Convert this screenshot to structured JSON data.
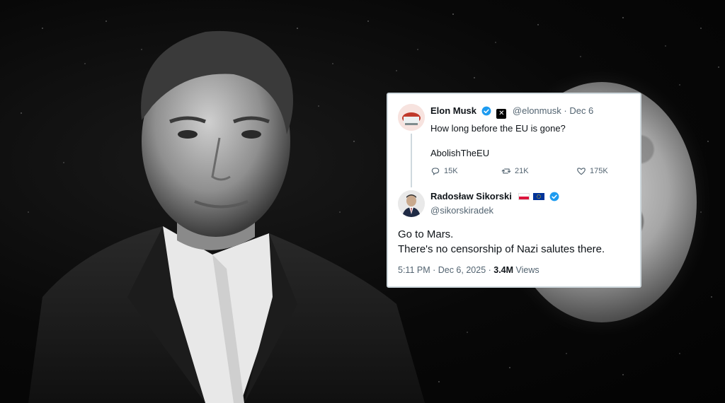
{
  "tweet": {
    "author_name": "Elon Musk",
    "author_handle": "@elonmusk",
    "date": "Dec 6",
    "line1": "How long before the EU is gone?",
    "line2": "AbolishTheEU",
    "replies": "15K",
    "reposts": "21K",
    "likes": "175K"
  },
  "reply": {
    "author_name": "Radosław Sikorski",
    "author_handle": "@sikorskiradek",
    "line1": "Go to Mars.",
    "line2": "There's no censorship of Nazi salutes there.",
    "time": "5:11 PM · Dec 6, 2025 · ",
    "views_count": "3.4M",
    "views_label": " Views"
  },
  "colors": {
    "verified": "#1d9bf0",
    "text": "#0f1419",
    "muted": "#536471",
    "border": "#cfd9de"
  },
  "icons": [
    "verified-badge-icon",
    "x-logo-icon",
    "reply-icon",
    "repost-icon",
    "like-icon",
    "poland-flag-icon",
    "eu-flag-icon"
  ]
}
